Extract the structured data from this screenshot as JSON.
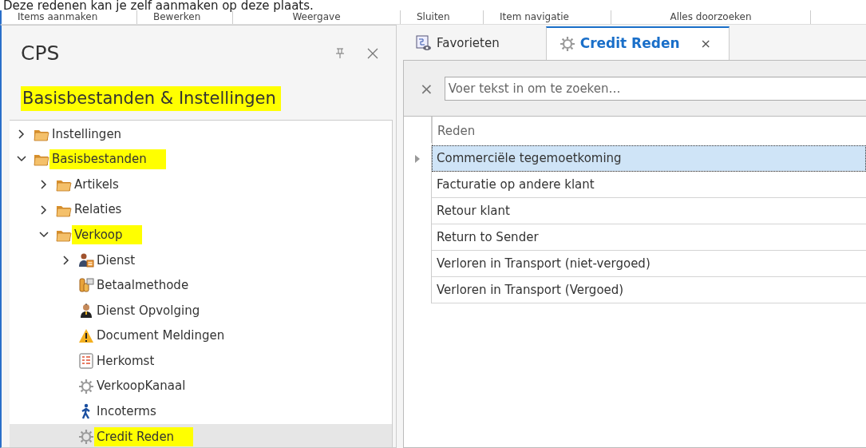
{
  "caption": "Deze redenen kan je zelf aanmaken op deze plaats.",
  "ribbon_groups": [
    "Items aanmaken",
    "Bewerken",
    "Weergave",
    "Sluiten",
    "Item navigatie",
    "Alles doorzoeken"
  ],
  "panel": {
    "title": "CPS",
    "subtitle": "Basisbestanden & Instellingen",
    "subtitle_highlighted": true
  },
  "tree": [
    {
      "label": "Instellingen",
      "kind": "folder",
      "expanded": false,
      "highlighted": false,
      "selected": false
    },
    {
      "label": "Basisbestanden",
      "kind": "folder",
      "expanded": true,
      "highlighted": true,
      "selected": false,
      "children": [
        {
          "label": "Artikels",
          "kind": "folder",
          "expanded": false,
          "highlighted": false,
          "selected": false
        },
        {
          "label": "Relaties",
          "kind": "folder",
          "expanded": false,
          "highlighted": false,
          "selected": false
        },
        {
          "label": "Verkoop",
          "kind": "folder",
          "expanded": true,
          "highlighted": true,
          "selected": false,
          "children": [
            {
              "label": "Dienst",
              "kind": "service",
              "expanded": false,
              "highlighted": false,
              "selected": false
            },
            {
              "label": "Betaalmethode",
              "kind": "payment",
              "highlighted": false,
              "selected": false
            },
            {
              "label": "Dienst Opvolging",
              "kind": "person",
              "highlighted": false,
              "selected": false
            },
            {
              "label": "Document Meldingen",
              "kind": "warning",
              "highlighted": false,
              "selected": false
            },
            {
              "label": "Herkomst",
              "kind": "list",
              "highlighted": false,
              "selected": false
            },
            {
              "label": "VerkoopKanaal",
              "kind": "gear",
              "highlighted": false,
              "selected": false
            },
            {
              "label": "Incoterms",
              "kind": "walker",
              "highlighted": false,
              "selected": false
            },
            {
              "label": "Credit Reden",
              "kind": "gear",
              "highlighted": true,
              "selected": true
            }
          ]
        }
      ]
    }
  ],
  "tabs": [
    {
      "label": "Favorieten",
      "kind": "favorites",
      "selected": false
    },
    {
      "label": "Credit Reden",
      "kind": "gear",
      "selected": true,
      "close": "×"
    }
  ],
  "search": {
    "clear": "×",
    "placeholder": "Voer tekst in om te zoeken…"
  },
  "table": {
    "columns": [
      "Reden"
    ],
    "rows": [
      {
        "reden": "Commerciële tegemoetkoming",
        "selected": true
      },
      {
        "reden": "Facturatie op andere klant",
        "selected": false
      },
      {
        "reden": "Retour klant",
        "selected": false
      },
      {
        "reden": "Return to Sender",
        "selected": false
      },
      {
        "reden": "Verloren in Transport (niet-vergoed)",
        "selected": false
      },
      {
        "reden": "Verloren in Transport (Vergoed)",
        "selected": false
      }
    ]
  }
}
